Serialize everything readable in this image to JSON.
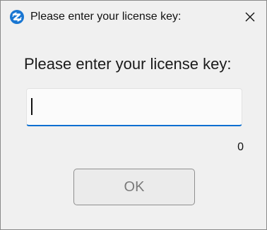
{
  "window": {
    "title": "Please enter your license key:",
    "app_icon": "circular-arrows-logo-icon",
    "close_icon": "close-icon"
  },
  "dialog": {
    "prompt": "Please enter your license key:",
    "license_input": {
      "value": "",
      "placeholder": ""
    },
    "char_count": "0",
    "ok_label": "OK"
  },
  "colors": {
    "accent": "#0a6fd1",
    "icon_blue": "#1976d2",
    "background": "#f0f0f0",
    "button_text_disabled": "#7a7a7a"
  }
}
